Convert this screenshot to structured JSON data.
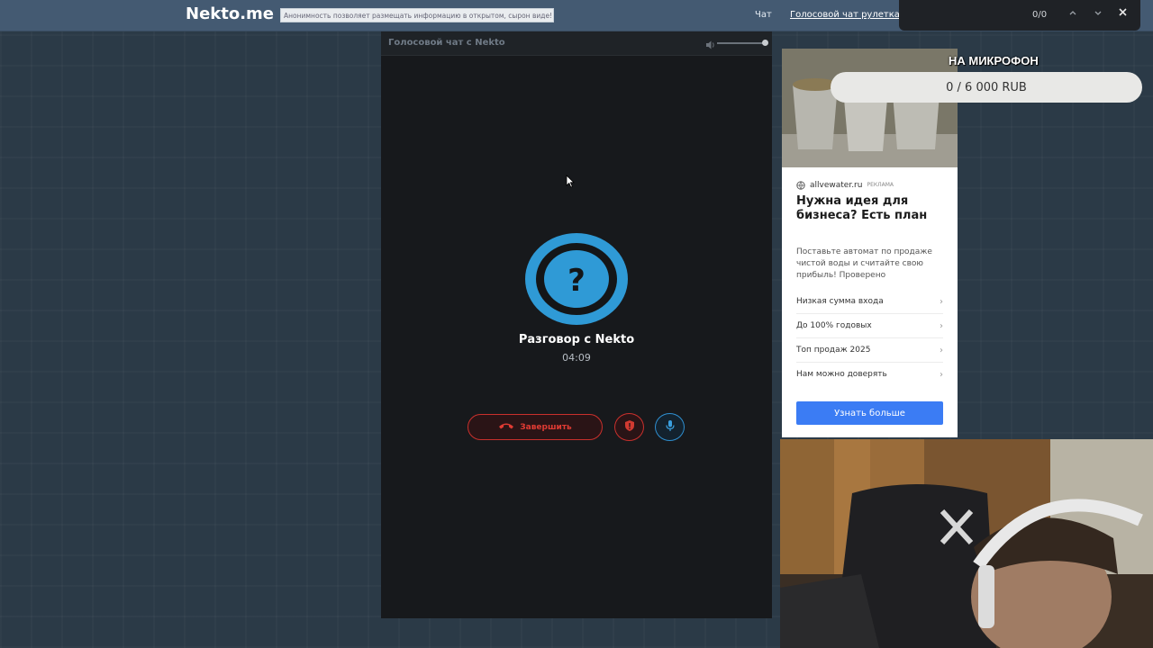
{
  "topbar": {
    "logo": "Nekto.me",
    "notice": "Анонимность позволяет размещать информацию в открытом, сырон виде!",
    "nav_chat": "Чат",
    "nav_voice_roulette": "Голосовой чат рулетка"
  },
  "findbar": {
    "count": "0/0",
    "prev_icon": "chevron-up-icon",
    "next_icon": "chevron-down-icon",
    "close_icon": "close-icon"
  },
  "call_panel": {
    "header_title": "Голосовой чат с Nekto",
    "volume_level": 1.0,
    "partner_name": "Разговор с Nekto",
    "timer": "04:09",
    "end_button_label": "Завершить",
    "colors": {
      "danger": "#c9302c",
      "accent": "#2f8fd0",
      "avatar": "#2f9ad6"
    }
  },
  "ad": {
    "domain": "allvewater.ru",
    "tag": "РЕКЛАМА",
    "headline": "Нужна идея для бизнеса? Есть план",
    "body": "Поставьте автомат по продаже чистой воды и считайте свою прибыль! Проверено",
    "items": [
      {
        "label": "Низкая сумма входа"
      },
      {
        "label": "До 100% годовых"
      },
      {
        "label": "Топ продаж 2025"
      },
      {
        "label": "Нам можно доверять"
      }
    ],
    "cta": "Узнать больше"
  },
  "donation": {
    "title": "НА МИКРОФОН",
    "goal_text": "0 / 6 000 RUB"
  }
}
